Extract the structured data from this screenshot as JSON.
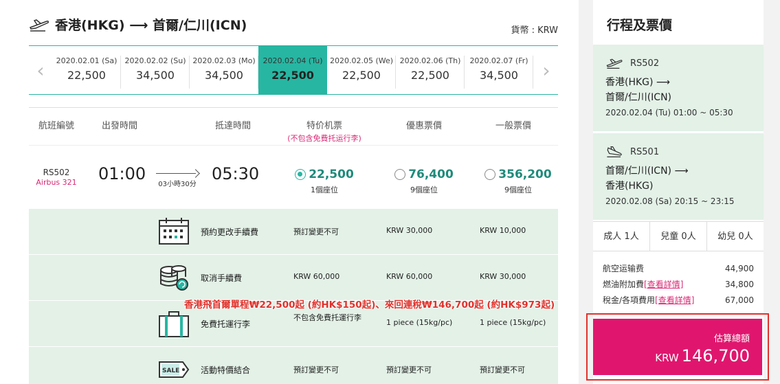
{
  "route": {
    "title": "香港(HKG) ⟶ 首爾/仁川(ICN)",
    "currency": "貨幣 : KRW"
  },
  "dates": [
    {
      "date": "2020.02.01 (Sa)",
      "price": "22,500"
    },
    {
      "date": "2020.02.02 (Su)",
      "price": "34,500"
    },
    {
      "date": "2020.02.03 (Mo)",
      "price": "34,500"
    },
    {
      "date": "2020.02.04 (Tu)",
      "price": "22,500",
      "active": true
    },
    {
      "date": "2020.02.05 (We)",
      "price": "22,500"
    },
    {
      "date": "2020.02.06 (Th)",
      "price": "22,500"
    },
    {
      "date": "2020.02.07 (Fr)",
      "price": "34,500"
    }
  ],
  "table_header": {
    "flight_no": "航班編號",
    "depart": "出發時間",
    "arrive": "抵達時間",
    "special": "特价机票",
    "special_note": "(不包含免費托运行李)",
    "discount": "優惠票價",
    "regular": "一般票價"
  },
  "flight": {
    "number": "RS502",
    "aircraft": "Airbus 321",
    "depart": "01:00",
    "duration": "03小時30分",
    "arrive": "05:30",
    "fares": [
      {
        "price": "22,500",
        "seats": "1個座位",
        "selected": true
      },
      {
        "price": "76,400",
        "seats": "9個座位",
        "selected": false
      },
      {
        "price": "356,200",
        "seats": "9個座位",
        "selected": false
      }
    ]
  },
  "conditions": [
    {
      "icon": "calendar-icon",
      "label": "預約更改手續費",
      "values": [
        "預訂變更不可",
        "KRW 30,000",
        "KRW 10,000"
      ]
    },
    {
      "icon": "coins-icon",
      "label": "取消手續費",
      "values": [
        "KRW 60,000",
        "KRW 60,000",
        "KRW 30,000"
      ]
    },
    {
      "icon": "luggage-icon",
      "label": "免費托運行李",
      "values": [
        "不包含免費托運行李",
        "1 piece (15kg/pc)",
        "1 piece (15kg/pc)"
      ]
    },
    {
      "icon": "sale-tag-icon",
      "label": "活動特價結合",
      "values": [
        "預訂變更不可",
        "預訂變更不可",
        "預訂變更不可"
      ]
    }
  ],
  "promo": "香港飛首爾單程₩22,500起 (約HK$150起)、來回連稅₩146,700起 (約HK$973起)",
  "summary": {
    "title": "行程及票價",
    "segments": [
      {
        "flight": "RS502",
        "from": "香港(HKG) ⟶",
        "to": "首爾/仁川(ICN)",
        "time": "2020.02.04 (Tu) 01:00 ~ 05:30"
      },
      {
        "flight": "RS501",
        "from": "首爾/仁川(ICN) ⟶",
        "to": "香港(HKG)",
        "time": "2020.02.08 (Sa) 20:15 ~ 23:15"
      }
    ],
    "pax": [
      "成人 1人",
      "兒童 0人",
      "幼兒 0人"
    ],
    "fees": [
      {
        "label": "航空运输费",
        "link": "",
        "value": "44,900"
      },
      {
        "label": "燃油附加費",
        "link": "[查看詳情]",
        "value": "34,800"
      },
      {
        "label": "稅金/各項費用",
        "link": "[查看詳情]",
        "value": "67,000"
      }
    ],
    "total_label": "估算總額",
    "total_currency": "KRW",
    "total_value": "146,700"
  },
  "colors": {
    "accent": "#27b6a2",
    "pink": "#e0166e",
    "panel_green": "#e3f1e7",
    "promo_red": "#e0322c"
  }
}
